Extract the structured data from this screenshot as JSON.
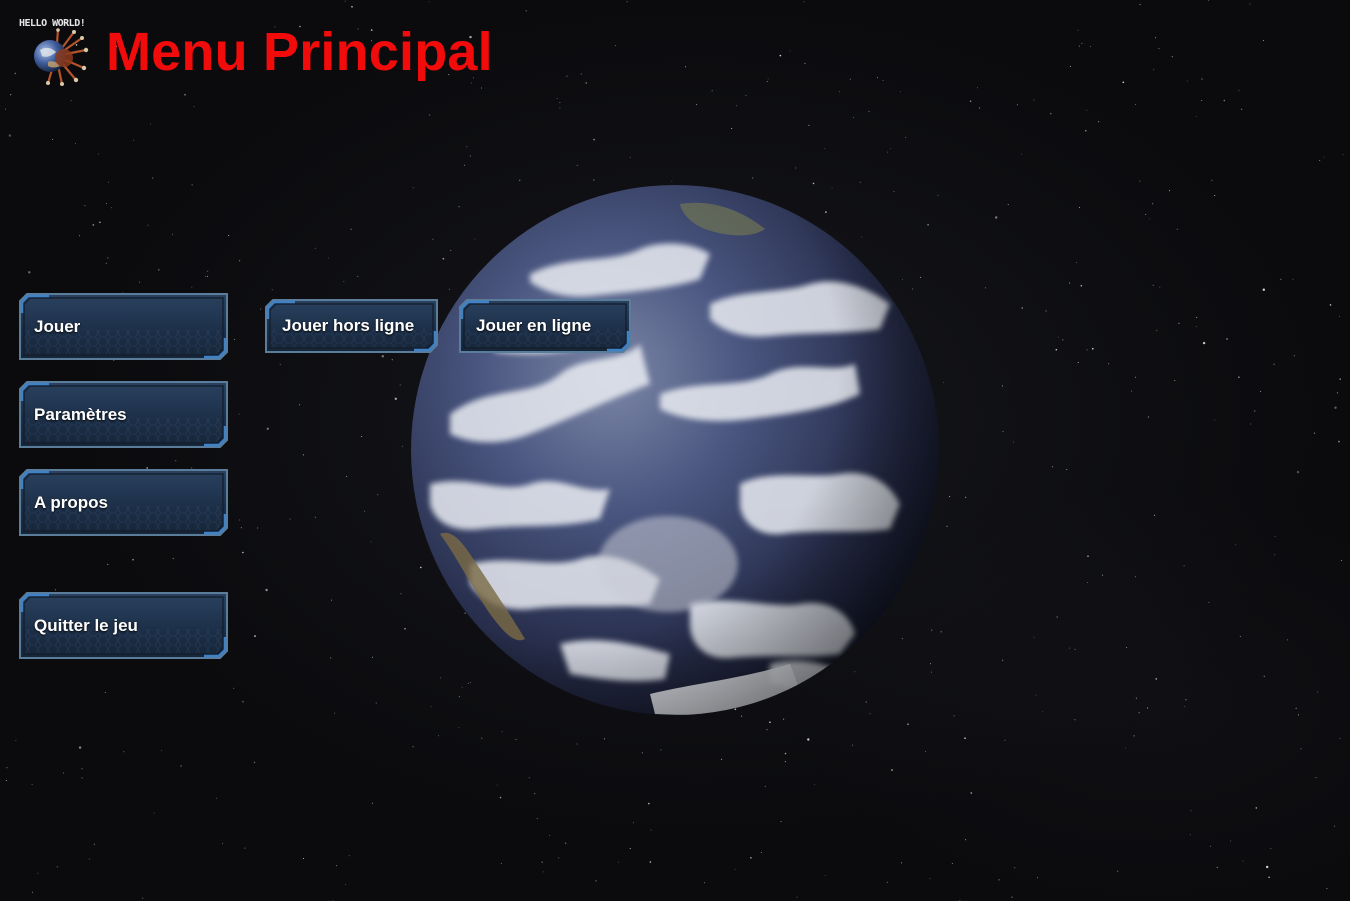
{
  "logo": {
    "text": "HELLO WORLD!",
    "icon": "earth-virus-logo-icon"
  },
  "header": {
    "title": "Menu Principal",
    "title_color": "#f20b0b"
  },
  "main_menu": {
    "items": [
      {
        "label": "Jouer"
      },
      {
        "label": "Paramètres"
      },
      {
        "label": "A propos"
      },
      {
        "label": "Quitter le jeu"
      }
    ]
  },
  "play_submenu": {
    "items": [
      {
        "label": "Jouer hors ligne"
      },
      {
        "label": "Jouer en ligne"
      }
    ]
  },
  "background": {
    "scene": "starfield-with-earth",
    "space_color": "#0b0b0e"
  },
  "button_style": {
    "fill_color": "#1d3049",
    "border_color": "#5a7d9c",
    "accent_color": "#3f82c8"
  }
}
